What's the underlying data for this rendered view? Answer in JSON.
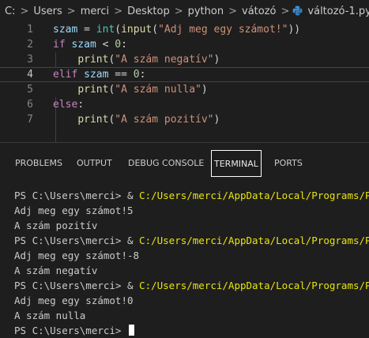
{
  "breadcrumb": {
    "items": [
      "C:",
      "Users",
      "merci",
      "Desktop",
      "python",
      "vátozó",
      "változó-1.py"
    ],
    "separator": ">",
    "file_icon": "python-file-icon"
  },
  "editor": {
    "line_numbers": [
      "1",
      "2",
      "3",
      "4",
      "5",
      "6",
      "7"
    ],
    "current_line": "4",
    "lines": [
      [
        {
          "t": "szam",
          "c": "var"
        },
        {
          "t": " = ",
          "c": "op"
        },
        {
          "t": "int",
          "c": "bi"
        },
        {
          "t": "(",
          "c": "op"
        },
        {
          "t": "input",
          "c": "fn"
        },
        {
          "t": "(",
          "c": "op"
        },
        {
          "t": "\"Adj meg egy számot!\"",
          "c": "str"
        },
        {
          "t": "))",
          "c": "op"
        }
      ],
      [
        {
          "t": "if",
          "c": "kw"
        },
        {
          "t": " ",
          "c": "op"
        },
        {
          "t": "szam",
          "c": "var"
        },
        {
          "t": " < ",
          "c": "op"
        },
        {
          "t": "0",
          "c": "num"
        },
        {
          "t": ":",
          "c": "op"
        }
      ],
      [
        {
          "t": "    ",
          "c": "op"
        },
        {
          "t": "print",
          "c": "fn"
        },
        {
          "t": "(",
          "c": "op"
        },
        {
          "t": "\"A szám negatív\"",
          "c": "str"
        },
        {
          "t": ")",
          "c": "op"
        }
      ],
      [
        {
          "t": "elif",
          "c": "kw"
        },
        {
          "t": " ",
          "c": "op"
        },
        {
          "t": "szam",
          "c": "var"
        },
        {
          "t": " == ",
          "c": "op"
        },
        {
          "t": "0",
          "c": "num"
        },
        {
          "t": ":",
          "c": "op"
        }
      ],
      [
        {
          "t": "    ",
          "c": "op"
        },
        {
          "t": "print",
          "c": "fn"
        },
        {
          "t": "(",
          "c": "op"
        },
        {
          "t": "\"A szám nulla\"",
          "c": "str"
        },
        {
          "t": ")",
          "c": "op"
        }
      ],
      [
        {
          "t": "else",
          "c": "kw"
        },
        {
          "t": ":",
          "c": "op"
        }
      ],
      [
        {
          "t": "    ",
          "c": "op"
        },
        {
          "t": "print",
          "c": "fn"
        },
        {
          "t": "(",
          "c": "op"
        },
        {
          "t": "\"A szám pozitív\"",
          "c": "str"
        },
        {
          "t": ")",
          "c": "op"
        }
      ]
    ]
  },
  "panel": {
    "tabs": [
      "PROBLEMS",
      "OUTPUT",
      "DEBUG CONSOLE",
      "TERMINAL",
      "PORTS"
    ],
    "active_tab": "TERMINAL"
  },
  "terminal": {
    "prompt": "PS C:\\Users\\merci> & ",
    "command_path": "C:/Users/merci/AppData/Local/Programs/Pytho",
    "runs": [
      {
        "input_line": "Adj meg egy számot!5",
        "output": "A szám pozitív"
      },
      {
        "input_line": "Adj meg egy számot!-8",
        "output": "A szám negatív"
      },
      {
        "input_line": "Adj meg egy számot!0",
        "output": "A szám nulla"
      }
    ],
    "final_prompt": "PS C:\\Users\\merci> "
  },
  "colors": {
    "background": "#1e1e1e",
    "keyword": "#c586c0",
    "variable": "#9cdcfe",
    "function": "#dcdcaa",
    "string": "#ce9178",
    "number": "#b5cea8",
    "builtin": "#4ec9b0",
    "terminal_path": "#e5e510"
  }
}
